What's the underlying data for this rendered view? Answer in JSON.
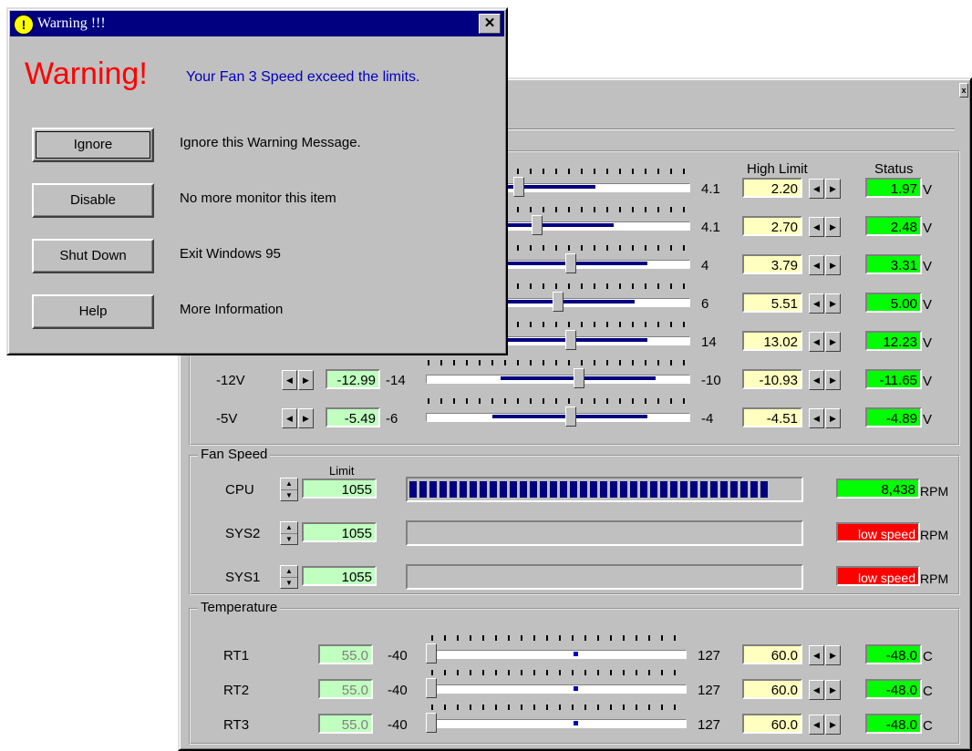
{
  "colors": {
    "status_ok": "#00ff00",
    "status_bad": "#ff0000",
    "limit_bg": "#ffffc0",
    "low_bg": "#c0ffc0",
    "title_bar": "#000080",
    "warning_red": "#ff0000",
    "message_blue": "#0000c0"
  },
  "monitor": {
    "headers": {
      "high_limit": "High Limit",
      "status": "Status"
    },
    "voltage_unit": "V",
    "voltages": [
      {
        "name": "",
        "low_limit": "",
        "low_range": "",
        "high_range": "4.1",
        "high_limit": "2.20",
        "status": "1.97",
        "level": 0.35
      },
      {
        "name": "",
        "low_limit": "",
        "low_range": "",
        "high_range": "4.1",
        "high_limit": "2.70",
        "status": "2.48",
        "level": 0.42
      },
      {
        "name": "",
        "low_limit": "",
        "low_range": "",
        "high_range": "4",
        "high_limit": "3.79",
        "status": "3.31",
        "level": 0.55
      },
      {
        "name": "",
        "low_limit": "",
        "low_range": "",
        "high_range": "6",
        "high_limit": "5.51",
        "status": "5.00",
        "level": 0.5
      },
      {
        "name": "",
        "low_limit": "",
        "low_range": "",
        "high_range": "14",
        "high_limit": "13.02",
        "status": "12.23",
        "level": 0.55
      },
      {
        "name": "-12V",
        "low_limit": "-12.99",
        "low_range": "-14",
        "high_range": "-10",
        "high_limit": "-10.93",
        "status": "-11.65",
        "level": 0.58
      },
      {
        "name": "-5V",
        "low_limit": "-5.49",
        "low_range": "-6",
        "high_range": "-4",
        "high_limit": "-4.51",
        "status": "-4.89",
        "level": 0.55
      }
    ],
    "fan": {
      "legend": "Fan Speed",
      "limit_header": "Limit",
      "unit": "RPM",
      "rows": [
        {
          "name": "CPU",
          "limit": "1055",
          "status": "8,438",
          "level": 0.93,
          "state": "ok"
        },
        {
          "name": "SYS2",
          "limit": "1055",
          "status": "low speed",
          "level": 0,
          "state": "bad"
        },
        {
          "name": "SYS1",
          "limit": "1055",
          "status": "low speed",
          "level": 0,
          "state": "bad"
        }
      ]
    },
    "temperature": {
      "legend": "Temperature",
      "unit": "C",
      "rows": [
        {
          "name": "RT1",
          "low_limit": "55.0",
          "low_range": "-40",
          "high_range": "127",
          "high_limit": "60.0",
          "status": "-48.0"
        },
        {
          "name": "RT2",
          "low_limit": "55.0",
          "low_range": "-40",
          "high_range": "127",
          "high_limit": "60.0",
          "status": "-48.0"
        },
        {
          "name": "RT3",
          "low_limit": "55.0",
          "low_range": "-40",
          "high_range": "127",
          "high_limit": "60.0",
          "status": "-48.0"
        }
      ]
    }
  },
  "warning_dialog": {
    "title": "Warning !!!",
    "close_glyph": "✕",
    "title_icon": "exclamation-icon",
    "heading": "Warning!",
    "message": "Your Fan 3 Speed exceed the limits.",
    "actions": [
      {
        "label": "Ignore",
        "description": "Ignore this Warning Message."
      },
      {
        "label": "Disable",
        "description": "No more monitor this item"
      },
      {
        "label": "Shut Down",
        "description": "Exit Windows 95"
      },
      {
        "label": "Help",
        "description": "More Information"
      }
    ]
  }
}
